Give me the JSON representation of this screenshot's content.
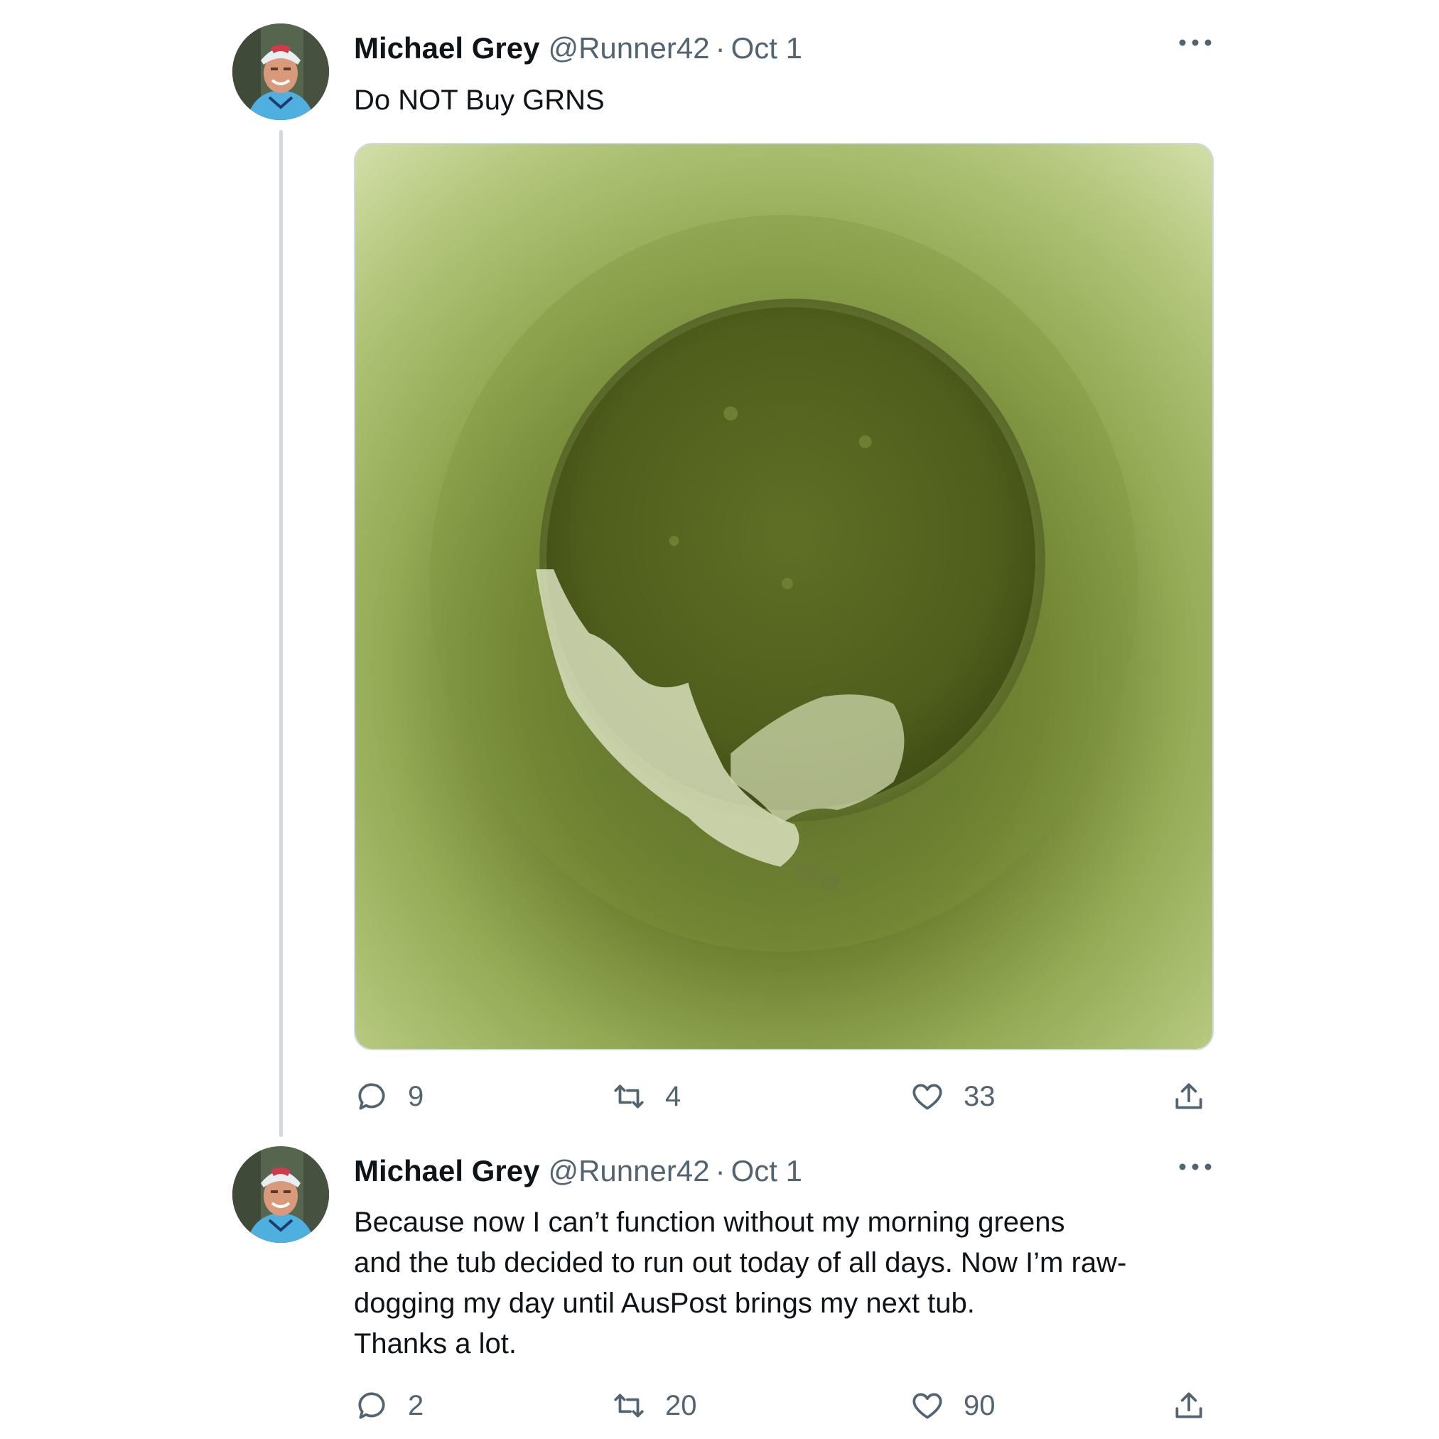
{
  "tweets": [
    {
      "author_name": "Michael Grey",
      "handle": "@Runner42",
      "separator": "·",
      "date": "Oct 1",
      "text_lines": [
        "Do NOT Buy GRNS"
      ],
      "actions": {
        "reply_count": "9",
        "retweet_count": "4",
        "like_count": "33"
      }
    },
    {
      "author_name": "Michael Grey",
      "handle": "@Runner42",
      "separator": "·",
      "date": "Oct 1",
      "text_lines": [
        "Because now I can’t function without my morning greens",
        "and the tub decided to run out today of all days.  Now I’m raw-",
        "dogging my day until AusPost brings my next tub.",
        "Thanks a lot."
      ],
      "actions": {
        "reply_count": "2",
        "retweet_count": "20",
        "like_count": "90"
      }
    }
  ],
  "icons": {
    "more": "more-horizontal-icon",
    "reply": "speech-bubble-icon",
    "retweet": "retweet-arrows-icon",
    "like": "heart-icon",
    "share": "share-upload-icon"
  },
  "colors": {
    "text": "#0f1419",
    "secondary": "#536471",
    "thread_line": "#cfd9de",
    "powder_green": "#5a6b2a",
    "tub_green": "#a8bd6c"
  }
}
